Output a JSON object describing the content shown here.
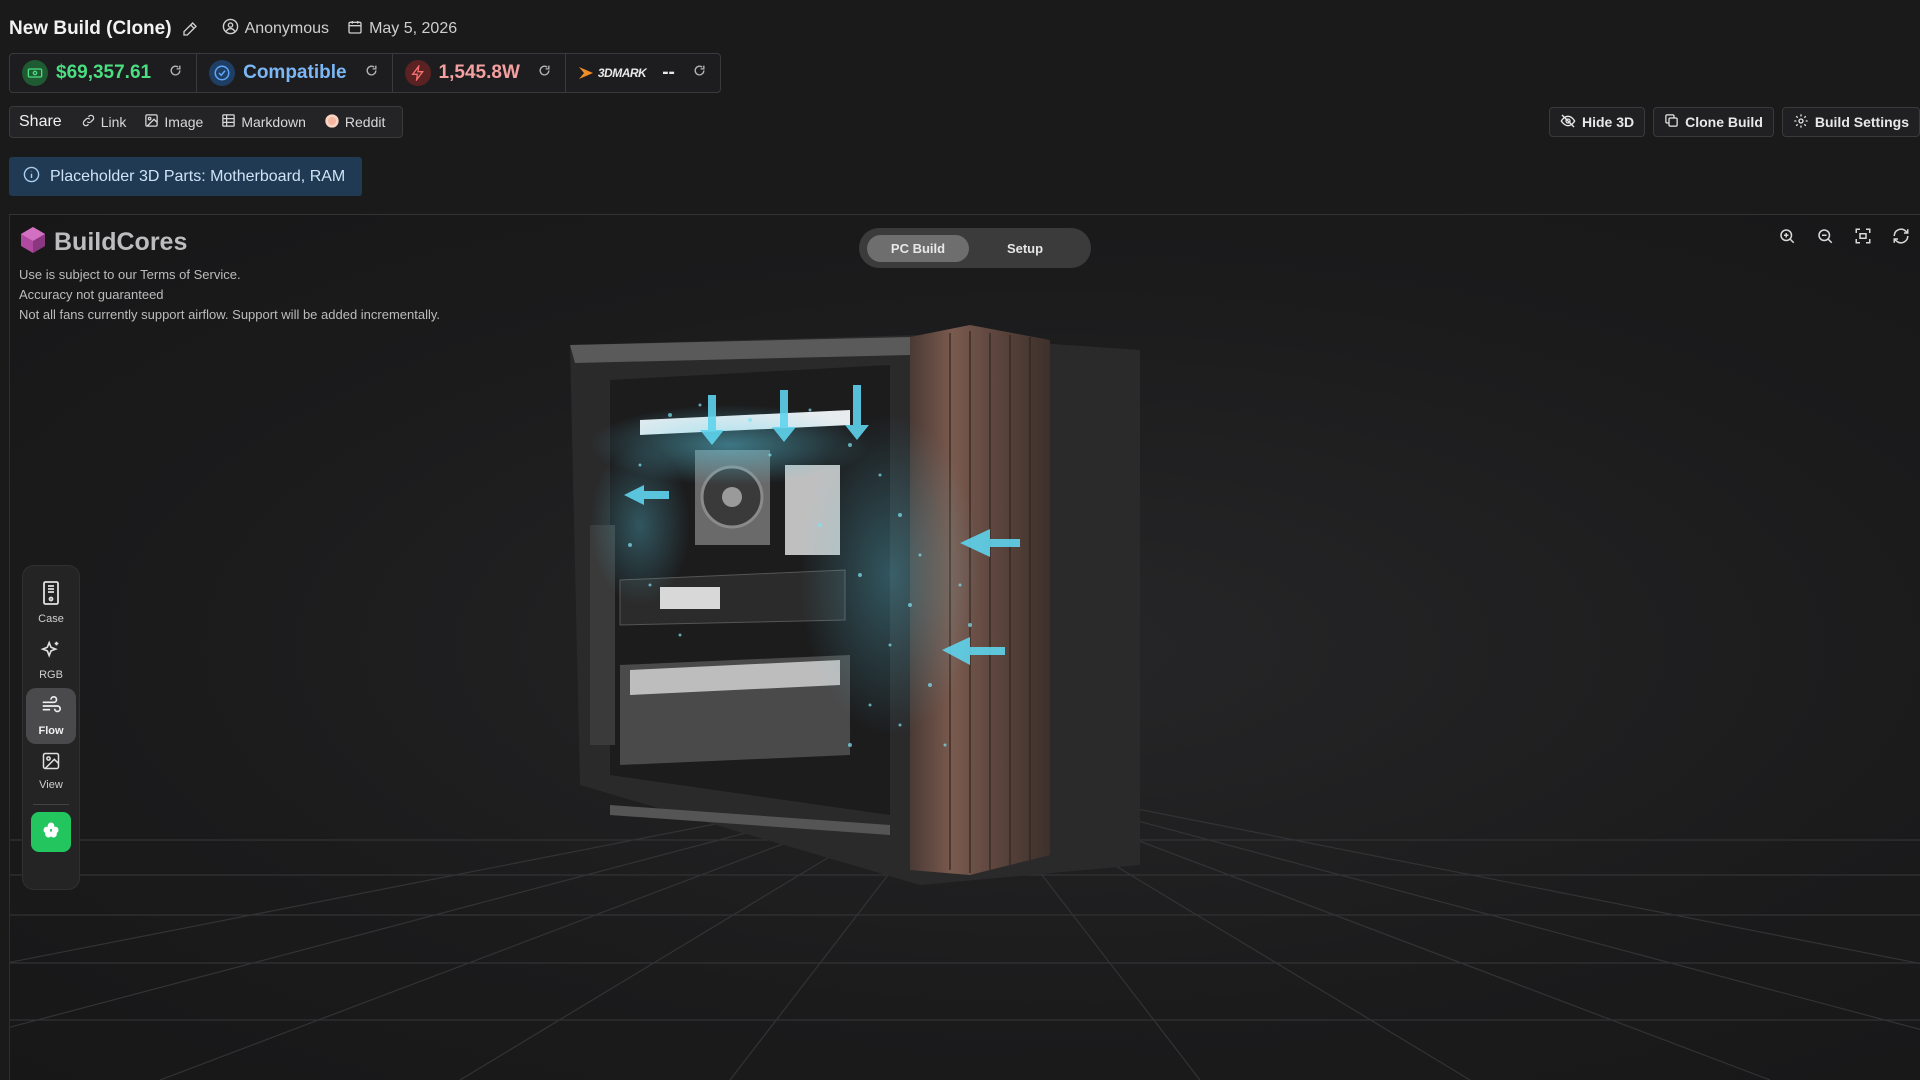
{
  "header": {
    "build_name": "New Build (Clone)",
    "author": "Anonymous",
    "date": "May 5, 2026"
  },
  "stats": {
    "price": "$69,357.61",
    "compatibility": "Compatible",
    "wattage": "1,545.8W",
    "benchmark_brand": "3DMARK",
    "benchmark_score": "--"
  },
  "share": {
    "label": "Share",
    "items": [
      "Link",
      "Image",
      "Markdown",
      "Reddit"
    ]
  },
  "actions": {
    "hide_3d": "Hide 3D",
    "clone_build": "Clone Build",
    "build_settings": "Build Settings"
  },
  "notice": "Placeholder 3D Parts: Motherboard, RAM",
  "viewer": {
    "brand": "BuildCores",
    "disclaimers": [
      "Use is subject to our Terms of Service.",
      "Accuracy not guaranteed",
      "Not all fans currently support airflow. Support will be added incrementally."
    ],
    "modes": [
      "PC Build",
      "Setup"
    ],
    "active_mode": "PC Build",
    "tools": [
      {
        "label": "Case",
        "icon": "case-icon"
      },
      {
        "label": "RGB",
        "icon": "sparkles-icon"
      },
      {
        "label": "Flow",
        "icon": "wind-icon"
      },
      {
        "label": "View",
        "icon": "image-icon"
      }
    ],
    "active_tool": "Flow"
  },
  "colors": {
    "price": "#4ade80",
    "compatible": "#60a5fa",
    "wattage": "#f87171",
    "airflow": "#5fd4ee",
    "green_button": "#22c55e",
    "notice_bg": "#1f3a52"
  }
}
